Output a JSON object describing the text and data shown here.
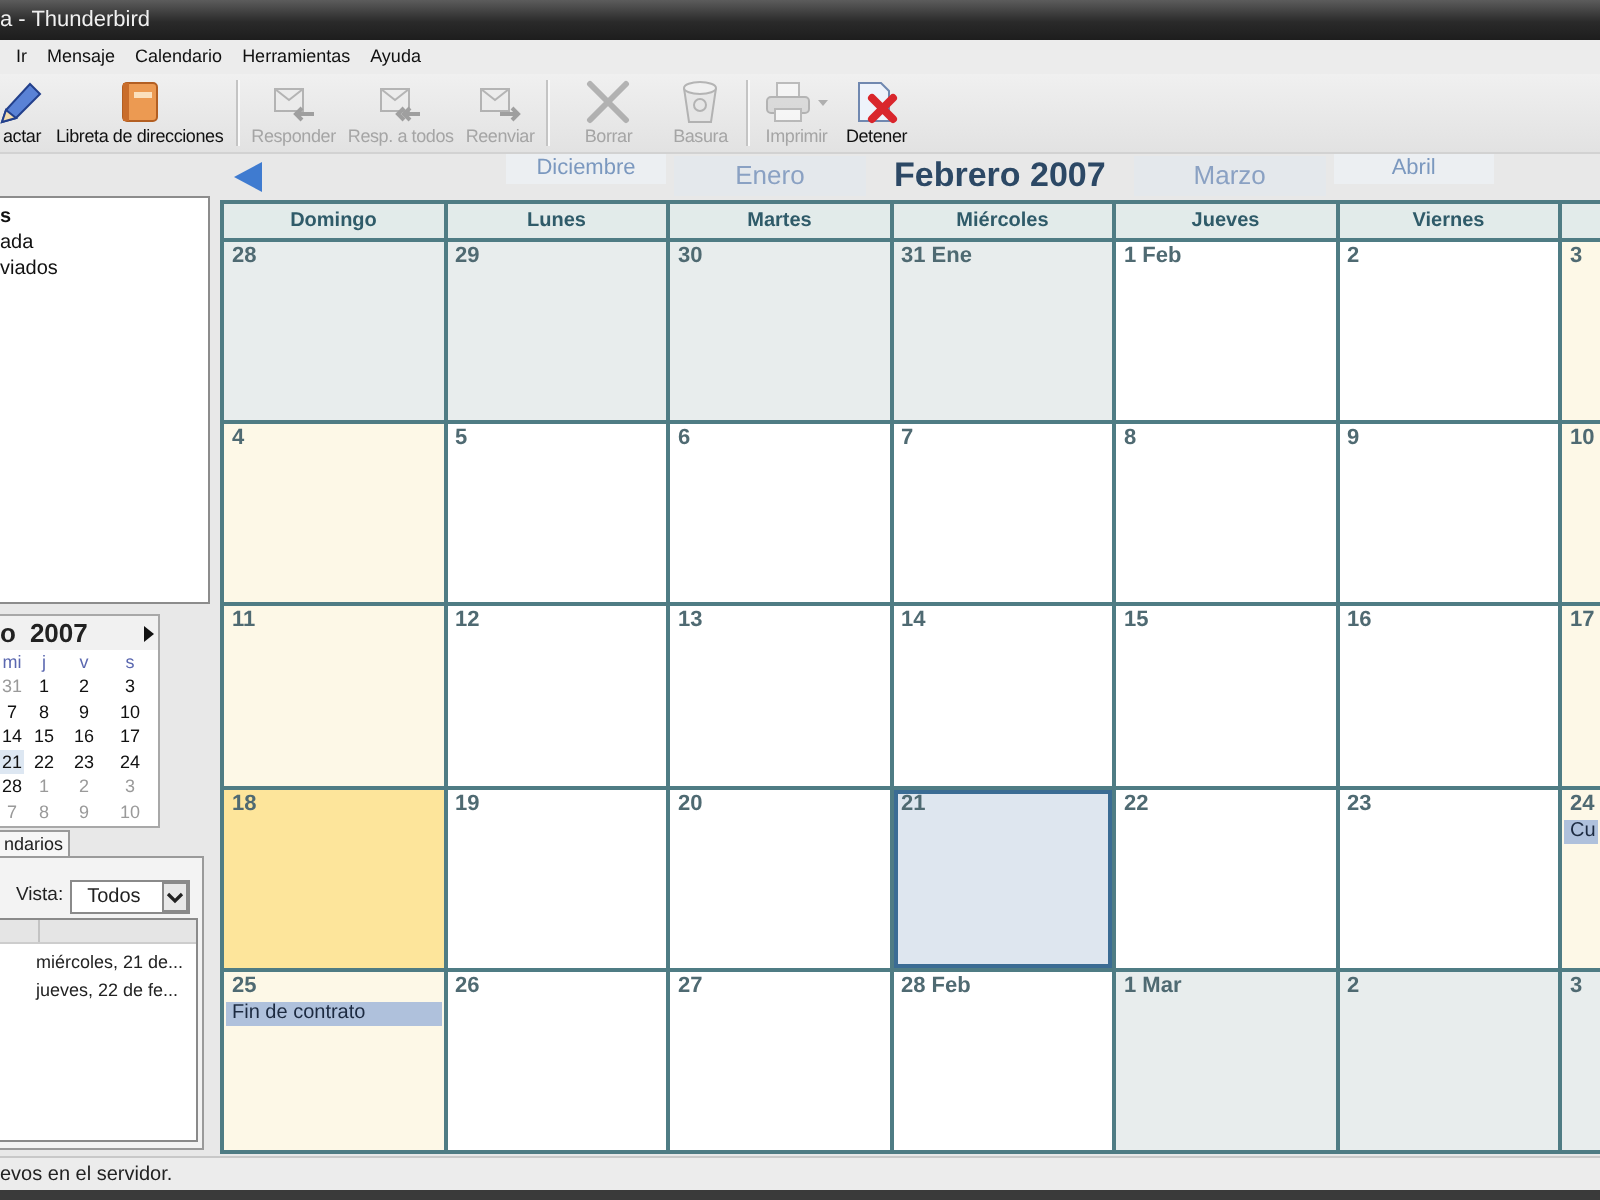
{
  "window": {
    "title": "a - Thunderbird"
  },
  "menu": [
    "Ir",
    "Mensaje",
    "Calendario",
    "Herramientas",
    "Ayuda"
  ],
  "toolbar": {
    "groups": [
      [
        {
          "label": "actar",
          "kind": "compose",
          "disabled": false,
          "dropdown": false
        },
        {
          "label": "Libreta de direcciones",
          "kind": "contacts",
          "disabled": false,
          "dropdown": false
        }
      ],
      [
        {
          "label": "Responder",
          "kind": "reply",
          "disabled": true,
          "dropdown": false
        },
        {
          "label": "Resp. a todos",
          "kind": "replyall",
          "disabled": true,
          "dropdown": false
        },
        {
          "label": "Reenviar",
          "kind": "forward",
          "disabled": true,
          "dropdown": false
        }
      ],
      [
        {
          "label": "Borrar",
          "kind": "delete",
          "disabled": true,
          "dropdown": false
        },
        {
          "label": "Basura",
          "kind": "junk",
          "disabled": true,
          "dropdown": false
        }
      ],
      [
        {
          "label": "Imprimir",
          "kind": "print",
          "disabled": true,
          "dropdown": true
        },
        {
          "label": "Detener",
          "kind": "stop",
          "disabled": false,
          "dropdown": false
        }
      ]
    ]
  },
  "folders": [
    {
      "label": "s",
      "children": [
        {
          "label": "ada"
        },
        {
          "label": "viados"
        }
      ]
    }
  ],
  "mini_calendar": {
    "month": "o",
    "year": "2007",
    "weekdays": [
      "mi",
      "j",
      "v",
      "s"
    ],
    "weeks": [
      [
        {
          "label": "31",
          "other": true,
          "selected": false
        },
        {
          "label": "1",
          "other": false,
          "selected": false
        },
        {
          "label": "2",
          "other": false,
          "selected": false
        },
        {
          "label": "3",
          "other": false,
          "selected": false
        }
      ],
      [
        {
          "label": "7",
          "other": false,
          "selected": false
        },
        {
          "label": "8",
          "other": false,
          "selected": false
        },
        {
          "label": "9",
          "other": false,
          "selected": false
        },
        {
          "label": "10",
          "other": false,
          "selected": false
        }
      ],
      [
        {
          "label": "14",
          "other": false,
          "selected": false
        },
        {
          "label": "15",
          "other": false,
          "selected": false
        },
        {
          "label": "16",
          "other": false,
          "selected": false
        },
        {
          "label": "17",
          "other": false,
          "selected": false
        }
      ],
      [
        {
          "label": "21",
          "other": false,
          "selected": true
        },
        {
          "label": "22",
          "other": false,
          "selected": false
        },
        {
          "label": "23",
          "other": false,
          "selected": false
        },
        {
          "label": "24",
          "other": false,
          "selected": false
        }
      ],
      [
        {
          "label": "28",
          "other": false,
          "selected": false
        },
        {
          "label": "1",
          "other": true,
          "selected": false
        },
        {
          "label": "2",
          "other": true,
          "selected": false
        },
        {
          "label": "3",
          "other": true,
          "selected": false
        }
      ],
      [
        {
          "label": "7",
          "other": true,
          "selected": false
        },
        {
          "label": "8",
          "other": true,
          "selected": false
        },
        {
          "label": "9",
          "other": true,
          "selected": false
        },
        {
          "label": "10",
          "other": true,
          "selected": false
        }
      ]
    ]
  },
  "calendars_tab": "ndarios",
  "view": {
    "label": "Vista:",
    "value": "Todos"
  },
  "event_list": [
    "miércoles, 21 de...",
    "jueves, 22 de fe..."
  ],
  "months": [
    {
      "label": "Diciembre",
      "selected": false
    },
    {
      "label": "Enero",
      "selected": false
    },
    {
      "label": "Febrero 2007",
      "selected": true
    },
    {
      "label": "Marzo",
      "selected": false
    },
    {
      "label": "Abril",
      "selected": false
    }
  ],
  "calendar": {
    "weekdays": [
      "Domingo",
      "Lunes",
      "Martes",
      "Miércoles",
      "Jueves",
      "Viernes"
    ],
    "weeks": [
      [
        {
          "label": "28",
          "kind": "other",
          "today": false,
          "selected": false
        },
        {
          "label": "29",
          "kind": "other",
          "today": false,
          "selected": false
        },
        {
          "label": "30",
          "kind": "other",
          "today": false,
          "selected": false
        },
        {
          "label": "31 Ene",
          "kind": "other",
          "today": false,
          "selected": false
        },
        {
          "label": "1 Feb",
          "kind": "weekday",
          "today": false,
          "selected": false
        },
        {
          "label": "2",
          "kind": "weekday",
          "today": false,
          "selected": false
        },
        {
          "label": "3",
          "kind": "weekend",
          "today": false,
          "selected": false
        }
      ],
      [
        {
          "label": "4",
          "kind": "weekend",
          "today": false,
          "selected": false
        },
        {
          "label": "5",
          "kind": "weekday",
          "today": false,
          "selected": false
        },
        {
          "label": "6",
          "kind": "weekday",
          "today": false,
          "selected": false
        },
        {
          "label": "7",
          "kind": "weekday",
          "today": false,
          "selected": false
        },
        {
          "label": "8",
          "kind": "weekday",
          "today": false,
          "selected": false
        },
        {
          "label": "9",
          "kind": "weekday",
          "today": false,
          "selected": false
        },
        {
          "label": "10",
          "kind": "weekend",
          "today": false,
          "selected": false
        }
      ],
      [
        {
          "label": "11",
          "kind": "weekend",
          "today": false,
          "selected": false
        },
        {
          "label": "12",
          "kind": "weekday",
          "today": false,
          "selected": false
        },
        {
          "label": "13",
          "kind": "weekday",
          "today": false,
          "selected": false
        },
        {
          "label": "14",
          "kind": "weekday",
          "today": false,
          "selected": false
        },
        {
          "label": "15",
          "kind": "weekday",
          "today": false,
          "selected": false
        },
        {
          "label": "16",
          "kind": "weekday",
          "today": false,
          "selected": false
        },
        {
          "label": "17",
          "kind": "weekend",
          "today": false,
          "selected": false
        }
      ],
      [
        {
          "label": "18",
          "kind": "weekend",
          "today": true,
          "selected": false
        },
        {
          "label": "19",
          "kind": "weekday",
          "today": false,
          "selected": false
        },
        {
          "label": "20",
          "kind": "weekday",
          "today": false,
          "selected": false
        },
        {
          "label": "21",
          "kind": "weekday",
          "today": false,
          "selected": true
        },
        {
          "label": "22",
          "kind": "weekday",
          "today": false,
          "selected": false
        },
        {
          "label": "23",
          "kind": "weekday",
          "today": false,
          "selected": false
        },
        {
          "label": "24",
          "kind": "weekend",
          "today": false,
          "selected": false,
          "events": [
            "Cu"
          ]
        }
      ],
      [
        {
          "label": "25",
          "kind": "weekend",
          "today": false,
          "selected": false,
          "events": [
            "Fin de contrato"
          ]
        },
        {
          "label": "26",
          "kind": "weekday",
          "today": false,
          "selected": false
        },
        {
          "label": "27",
          "kind": "weekday",
          "today": false,
          "selected": false
        },
        {
          "label": "28 Feb",
          "kind": "weekday",
          "today": false,
          "selected": false
        },
        {
          "label": "1 Mar",
          "kind": "other",
          "today": false,
          "selected": false
        },
        {
          "label": "2",
          "kind": "other",
          "today": false,
          "selected": false
        },
        {
          "label": "3",
          "kind": "other",
          "today": false,
          "selected": false
        }
      ]
    ]
  },
  "status_bar": "evos en el servidor."
}
